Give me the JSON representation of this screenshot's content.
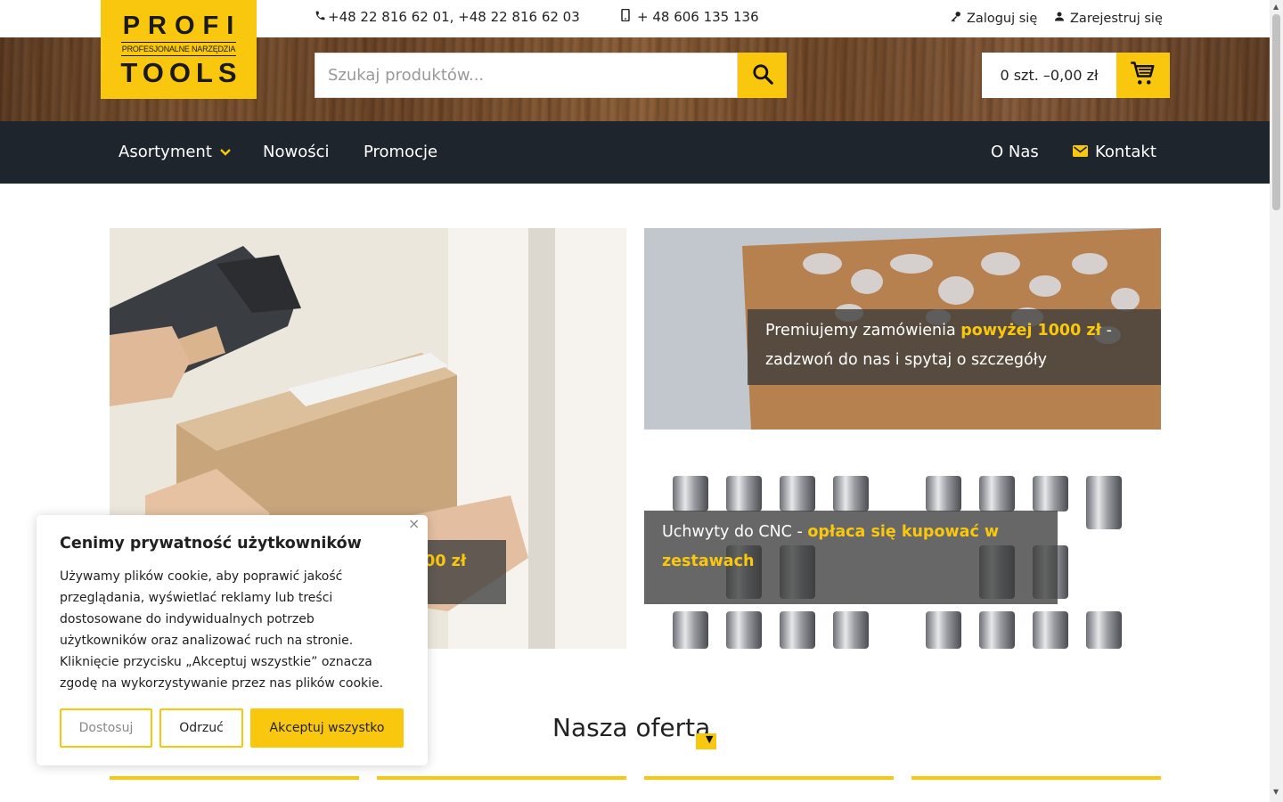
{
  "brand": {
    "line1": "PROFI",
    "line2": "PROFESJONALNE NARZĘDZIA",
    "line3": "TOOLS",
    "accent_color": "#f9c80e",
    "nav_color": "#1e252d"
  },
  "contact": {
    "phone_landline": "+48 22 816 62 01, +48 22 816 62 03",
    "phone_mobile": "+ 48 606 135 136"
  },
  "account": {
    "login": "Zaloguj się",
    "register": "Zarejestruj się"
  },
  "search": {
    "placeholder": "Szukaj produktów..."
  },
  "cart": {
    "summary": "0 szt. –0,00 zł"
  },
  "nav": {
    "assortment": "Asortyment",
    "new": "Nowości",
    "promo": "Promocje",
    "about": "O Nas",
    "contact": "Kontakt"
  },
  "banners": {
    "left": {
      "highlight": "ej 500 zł"
    },
    "top_right": {
      "pre": "Premiujemy zamówienia ",
      "highlight": "powyżej 1000 zł",
      "post": " - zadzwoń do nas i spytaj o szczegóły"
    },
    "bottom_right": {
      "pre": "Uchwyty do CNC - ",
      "highlight": "opłaca się kupować w zestawach"
    }
  },
  "offer": {
    "title": "Nasza oferta"
  },
  "cookie": {
    "title": "Cenimy prywatność użytkowników",
    "text": "Używamy plików cookie, aby poprawić jakość przeglądania, wyświetlać reklamy lub treści dostosowane do indywidualnych potrzeb użytkowników oraz analizować ruch na stronie. Kliknięcie przycisku „Akceptuj wszystkie” oznacza zgodę na wykorzystywanie przez nas plików cookie.",
    "customize": "Dostosuj",
    "reject": "Odrzuć",
    "accept": "Akceptuj wszystko"
  },
  "icons": [
    "phone-icon",
    "mobile-icon",
    "key-icon",
    "user-icon",
    "search-icon",
    "cart-icon",
    "chevron-down-icon",
    "mail-icon",
    "close-icon"
  ]
}
